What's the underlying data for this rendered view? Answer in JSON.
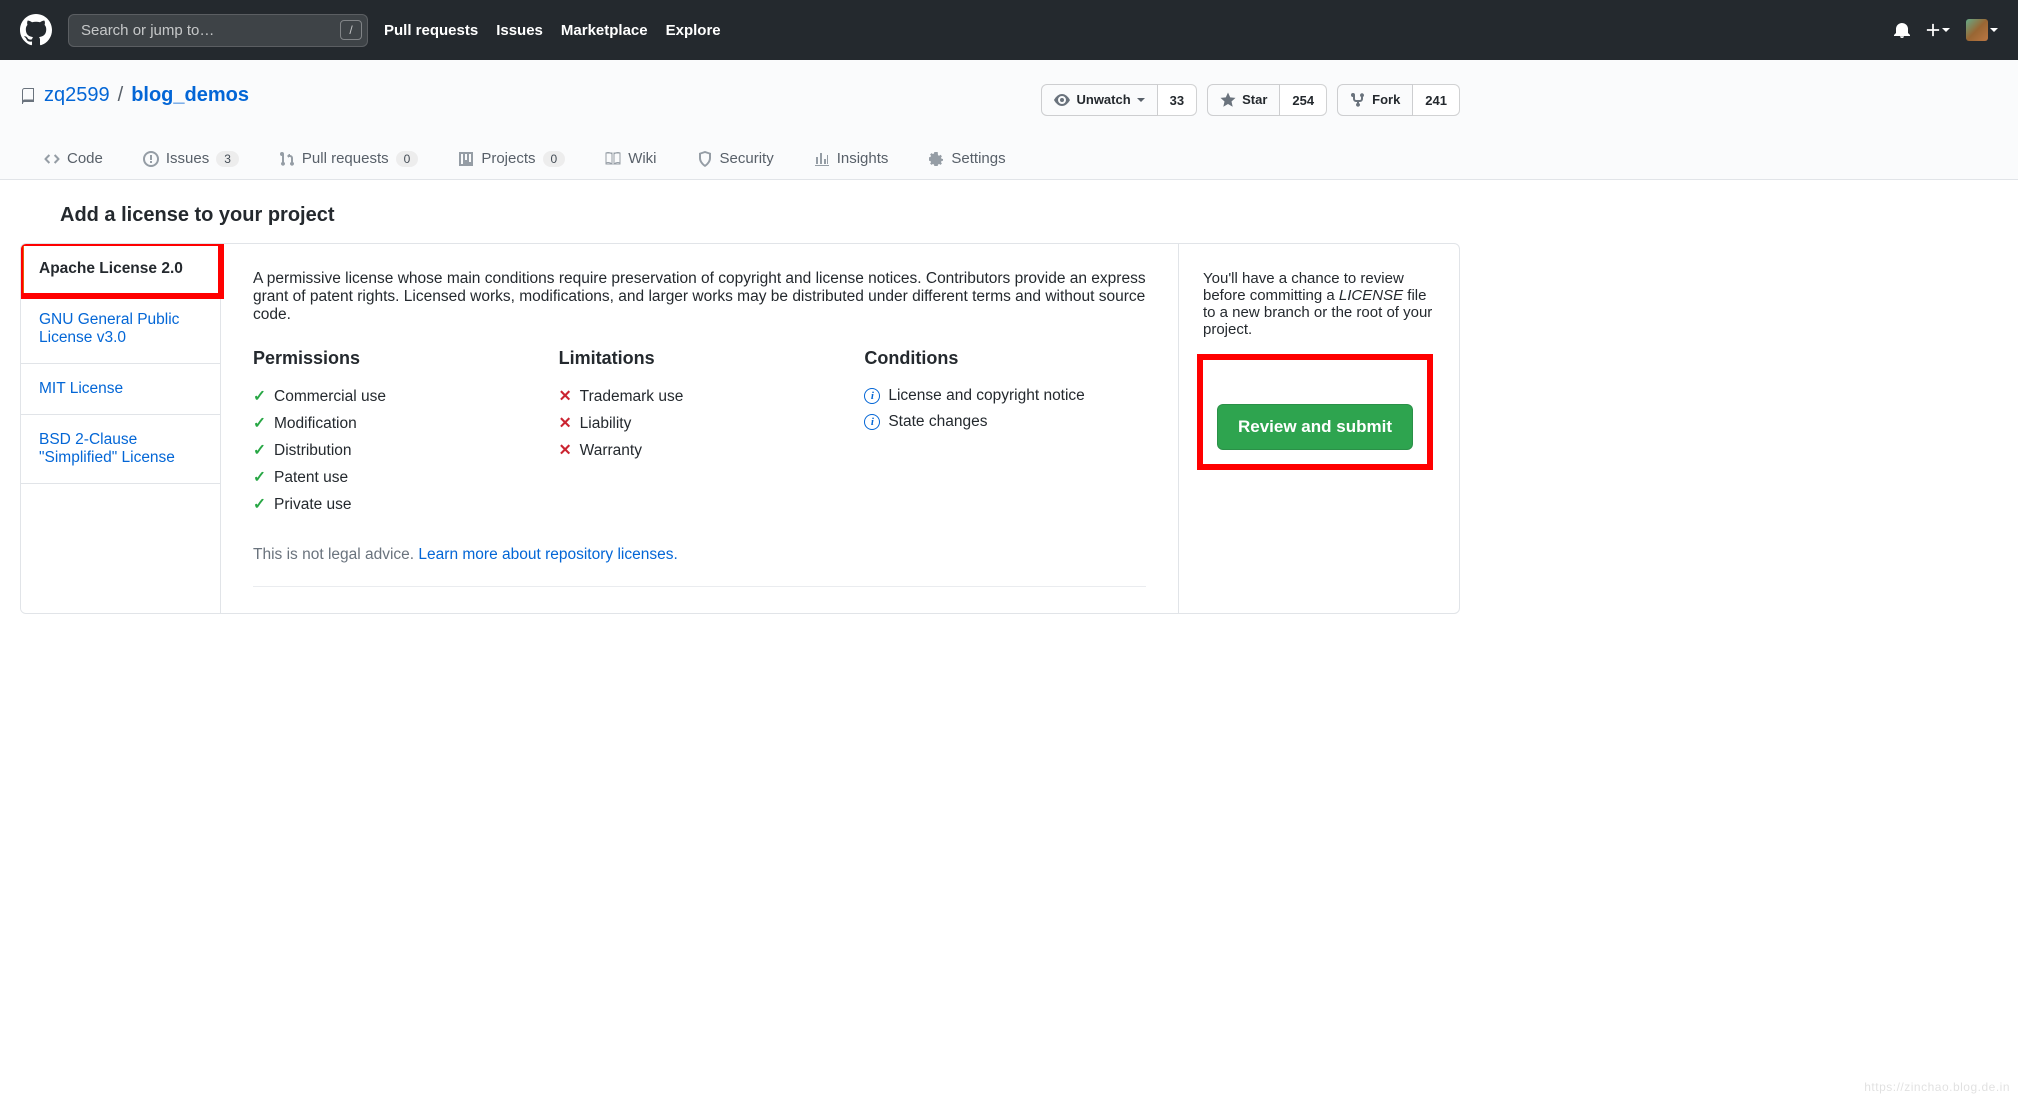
{
  "header": {
    "search_placeholder": "Search or jump to…",
    "slash_hint": "/",
    "nav": {
      "pulls": "Pull requests",
      "issues": "Issues",
      "market": "Marketplace",
      "explore": "Explore"
    }
  },
  "repo": {
    "owner": "zq2599",
    "separator": "/",
    "name": "blog_demos",
    "actions": {
      "unwatch_label": "Unwatch",
      "unwatch_count": "33",
      "star_label": "Star",
      "star_count": "254",
      "fork_label": "Fork",
      "fork_count": "241"
    },
    "tabs": {
      "code": "Code",
      "issues": "Issues",
      "issues_count": "3",
      "pulls": "Pull requests",
      "pulls_count": "0",
      "projects": "Projects",
      "projects_count": "0",
      "wiki": "Wiki",
      "security": "Security",
      "insights": "Insights",
      "settings": "Settings"
    }
  },
  "page": {
    "title": "Add a license to your project"
  },
  "licenses": {
    "items": [
      {
        "label": "Apache License 2.0"
      },
      {
        "label": "GNU General Public License v3.0"
      },
      {
        "label": "MIT License"
      },
      {
        "label": "BSD 2-Clause \"Simplified\" License"
      }
    ]
  },
  "details": {
    "description": "A permissive license whose main conditions require preservation of copyright and license notices. Contributors provide an express grant of patent rights. Licensed works, modifications, and larger works may be distributed under different terms and without source code.",
    "permissions": {
      "heading": "Permissions",
      "items": [
        "Commercial use",
        "Modification",
        "Distribution",
        "Patent use",
        "Private use"
      ]
    },
    "limitations": {
      "heading": "Limitations",
      "items": [
        "Trademark use",
        "Liability",
        "Warranty"
      ]
    },
    "conditions": {
      "heading": "Conditions",
      "items": [
        "License and copyright notice",
        "State changes"
      ]
    },
    "legal_prefix": "This is not legal advice. ",
    "legal_link": "Learn more about repository licenses."
  },
  "right": {
    "note_1": "You'll have a chance to review before committing a ",
    "note_license_word": "LICENSE",
    "note_2": " file to a new branch or the root of your project.",
    "submit": "Review and submit"
  },
  "watermark": "https://zinchao.blog.de.in"
}
